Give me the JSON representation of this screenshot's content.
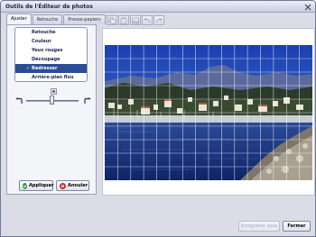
{
  "window": {
    "title": "Outils de l'Éditeur de photos"
  },
  "tabs": [
    {
      "label": "Ajuster",
      "active": true
    },
    {
      "label": "Retouche",
      "active": false
    },
    {
      "label": "Presse-papiers",
      "active": false
    }
  ],
  "menu": {
    "items": [
      {
        "label": "Retouche",
        "selected": false
      },
      {
        "label": "Couleur",
        "selected": false
      },
      {
        "label": "Yeux rouges",
        "selected": false
      },
      {
        "label": "Découpage",
        "selected": false
      },
      {
        "label": "Redresser",
        "selected": true
      },
      {
        "label": "Arrière-plan flou",
        "selected": false
      }
    ],
    "check_glyph": "✓"
  },
  "straighten": {
    "slider_level": 0.5
  },
  "buttons": {
    "apply_label": "Appliquer",
    "cancel_label": "Annuler",
    "save_label": "Enregistrer sous",
    "close_label": "Fermer"
  },
  "toolbar_icons": [
    "copy-icon",
    "paste-icon",
    "image-icon",
    "undo-icon",
    "redo-icon"
  ],
  "colors": {
    "selection": "#2d4c96",
    "apply_icon": "#2e9a2e",
    "cancel_icon": "#c8302a"
  }
}
